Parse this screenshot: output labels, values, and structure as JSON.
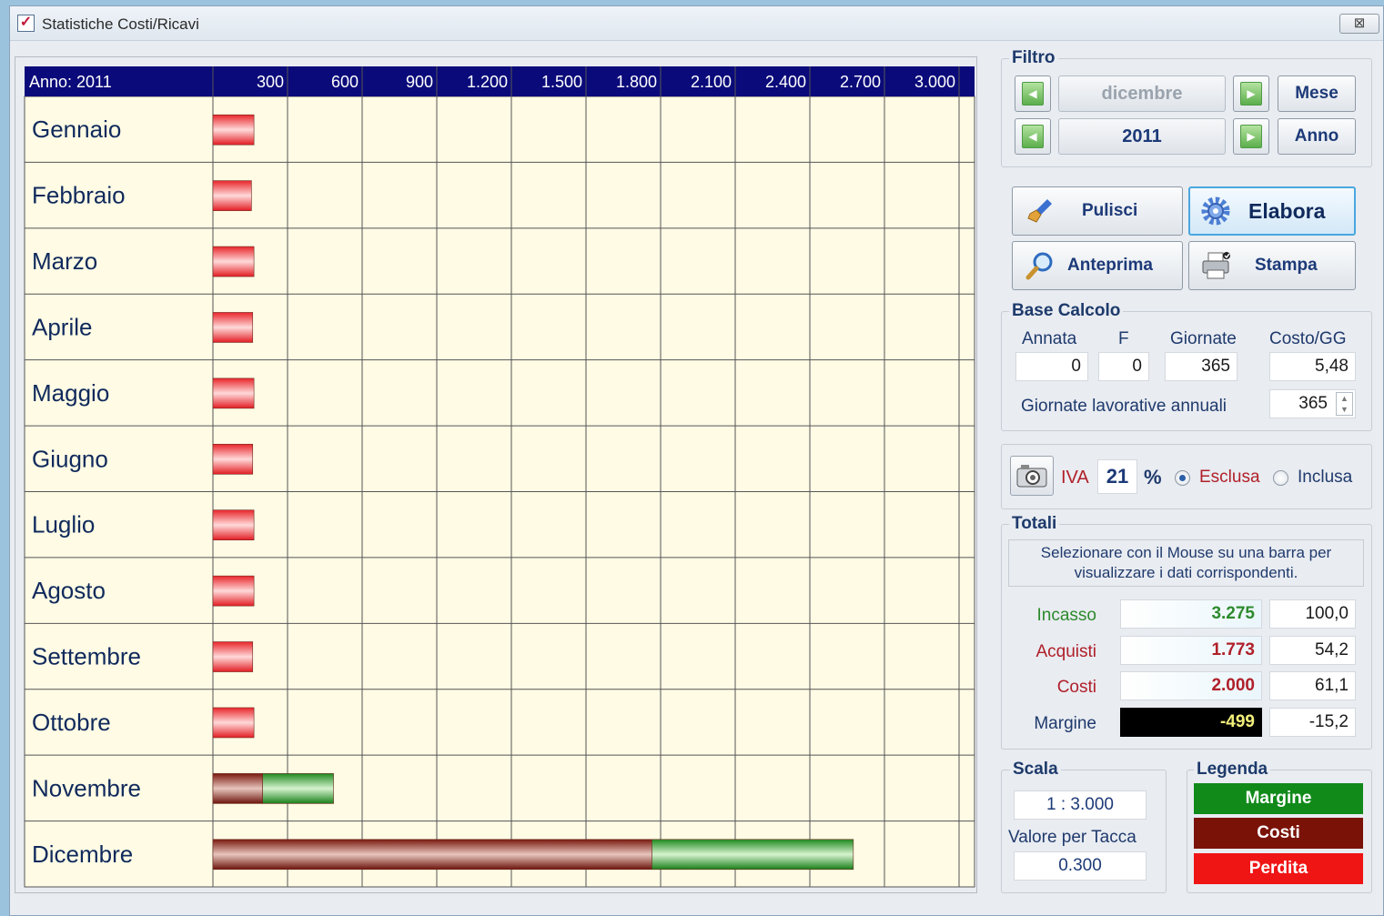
{
  "window": {
    "title": "Statistiche Costi/Ricavi",
    "close_label": "⊠"
  },
  "chart_data": {
    "type": "bar",
    "orientation": "horizontal",
    "stacked": true,
    "title": "Anno: 2011",
    "x_ticks": [
      "300",
      "600",
      "900",
      "1.200",
      "1.500",
      "1.800",
      "2.100",
      "2.400",
      "2.700",
      "3.000"
    ],
    "xlim": [
      0,
      3150
    ],
    "tick_step": 300,
    "categories": [
      "Gennaio",
      "Febbraio",
      "Marzo",
      "Aprile",
      "Maggio",
      "Giugno",
      "Luglio",
      "Agosto",
      "Settembre",
      "Ottobre",
      "Novembre",
      "Dicembre"
    ],
    "series": [
      {
        "name": "Perdita",
        "color": "#e8262b",
        "values": [
          165,
          155,
          165,
          160,
          165,
          160,
          165,
          165,
          160,
          165,
          0,
          0
        ]
      },
      {
        "name": "Costi",
        "color": "#7a1a10",
        "values": [
          0,
          0,
          0,
          0,
          0,
          0,
          0,
          0,
          0,
          0,
          200,
          1765
        ]
      },
      {
        "name": "Margine",
        "color": "#1f8a1f",
        "values": [
          0,
          0,
          0,
          0,
          0,
          0,
          0,
          0,
          0,
          0,
          285,
          810
        ]
      }
    ],
    "grid": true,
    "background": "#fffbe5",
    "header_color": "#0a0a7a"
  },
  "filtro": {
    "title": "Filtro",
    "month": "dicembre",
    "year": "2011",
    "month_btn": "Mese",
    "year_btn": "Anno"
  },
  "actions": {
    "pulisci": "Pulisci",
    "elabora": "Elabora",
    "anteprima": "Anteprima",
    "stampa": "Stampa"
  },
  "base": {
    "title": "Base Calcolo",
    "h_annata": "Annata",
    "h_f": "F",
    "h_giornate": "Giornate",
    "h_costo": "Costo/GG",
    "annata": "0",
    "f": "0",
    "giornate": "365",
    "costo": "5,48",
    "lavorative_label": "Giornate lavorative annuali",
    "lavorative": "365"
  },
  "iva": {
    "label": "IVA",
    "value": "21",
    "pct": "%",
    "esclusa": "Esclusa",
    "inclusa": "Inclusa",
    "selected": "Esclusa"
  },
  "totali": {
    "title": "Totali",
    "hint": "Selezionare con il Mouse su una barra per visualizzare i dati corrispondenti.",
    "rows": [
      {
        "label": "Incasso",
        "value": "3.275",
        "pct": "100,0",
        "color": "#2d8a2d"
      },
      {
        "label": "Acquisti",
        "value": "1.773",
        "pct": "54,2",
        "color": "#b0202a"
      },
      {
        "label": "Costi",
        "value": "2.000",
        "pct": "61,1",
        "color": "#b0202a"
      },
      {
        "label": "Margine",
        "value": "-499",
        "pct": "-15,2",
        "color": "#1f3a6d"
      }
    ]
  },
  "scala": {
    "title": "Scala",
    "value": "1 : 3.000",
    "tacca_label": "Valore per Tacca",
    "tacca": "0.300"
  },
  "legenda": {
    "title": "Legenda",
    "items": [
      {
        "label": "Margine",
        "color": "#118a1a"
      },
      {
        "label": "Costi",
        "color": "#7a1208"
      },
      {
        "label": "Perdita",
        "color": "#f01515"
      }
    ]
  }
}
